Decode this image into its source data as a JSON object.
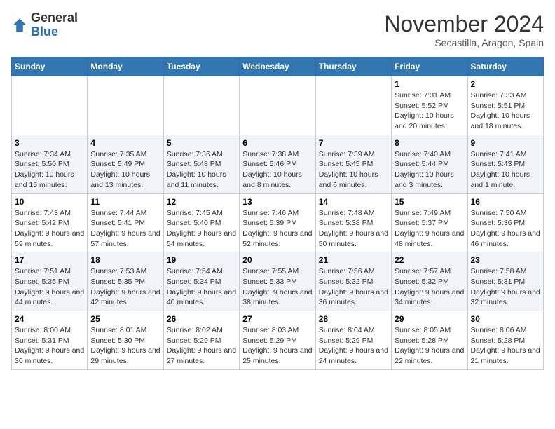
{
  "header": {
    "logo_general": "General",
    "logo_blue": "Blue",
    "month": "November 2024",
    "location": "Secastilla, Aragon, Spain"
  },
  "weekdays": [
    "Sunday",
    "Monday",
    "Tuesday",
    "Wednesday",
    "Thursday",
    "Friday",
    "Saturday"
  ],
  "weeks": [
    [
      {
        "day": "",
        "content": ""
      },
      {
        "day": "",
        "content": ""
      },
      {
        "day": "",
        "content": ""
      },
      {
        "day": "",
        "content": ""
      },
      {
        "day": "",
        "content": ""
      },
      {
        "day": "1",
        "content": "Sunrise: 7:31 AM\nSunset: 5:52 PM\nDaylight: 10 hours and 20 minutes."
      },
      {
        "day": "2",
        "content": "Sunrise: 7:33 AM\nSunset: 5:51 PM\nDaylight: 10 hours and 18 minutes."
      }
    ],
    [
      {
        "day": "3",
        "content": "Sunrise: 7:34 AM\nSunset: 5:50 PM\nDaylight: 10 hours and 15 minutes."
      },
      {
        "day": "4",
        "content": "Sunrise: 7:35 AM\nSunset: 5:49 PM\nDaylight: 10 hours and 13 minutes."
      },
      {
        "day": "5",
        "content": "Sunrise: 7:36 AM\nSunset: 5:48 PM\nDaylight: 10 hours and 11 minutes."
      },
      {
        "day": "6",
        "content": "Sunrise: 7:38 AM\nSunset: 5:46 PM\nDaylight: 10 hours and 8 minutes."
      },
      {
        "day": "7",
        "content": "Sunrise: 7:39 AM\nSunset: 5:45 PM\nDaylight: 10 hours and 6 minutes."
      },
      {
        "day": "8",
        "content": "Sunrise: 7:40 AM\nSunset: 5:44 PM\nDaylight: 10 hours and 3 minutes."
      },
      {
        "day": "9",
        "content": "Sunrise: 7:41 AM\nSunset: 5:43 PM\nDaylight: 10 hours and 1 minute."
      }
    ],
    [
      {
        "day": "10",
        "content": "Sunrise: 7:43 AM\nSunset: 5:42 PM\nDaylight: 9 hours and 59 minutes."
      },
      {
        "day": "11",
        "content": "Sunrise: 7:44 AM\nSunset: 5:41 PM\nDaylight: 9 hours and 57 minutes."
      },
      {
        "day": "12",
        "content": "Sunrise: 7:45 AM\nSunset: 5:40 PM\nDaylight: 9 hours and 54 minutes."
      },
      {
        "day": "13",
        "content": "Sunrise: 7:46 AM\nSunset: 5:39 PM\nDaylight: 9 hours and 52 minutes."
      },
      {
        "day": "14",
        "content": "Sunrise: 7:48 AM\nSunset: 5:38 PM\nDaylight: 9 hours and 50 minutes."
      },
      {
        "day": "15",
        "content": "Sunrise: 7:49 AM\nSunset: 5:37 PM\nDaylight: 9 hours and 48 minutes."
      },
      {
        "day": "16",
        "content": "Sunrise: 7:50 AM\nSunset: 5:36 PM\nDaylight: 9 hours and 46 minutes."
      }
    ],
    [
      {
        "day": "17",
        "content": "Sunrise: 7:51 AM\nSunset: 5:35 PM\nDaylight: 9 hours and 44 minutes."
      },
      {
        "day": "18",
        "content": "Sunrise: 7:53 AM\nSunset: 5:35 PM\nDaylight: 9 hours and 42 minutes."
      },
      {
        "day": "19",
        "content": "Sunrise: 7:54 AM\nSunset: 5:34 PM\nDaylight: 9 hours and 40 minutes."
      },
      {
        "day": "20",
        "content": "Sunrise: 7:55 AM\nSunset: 5:33 PM\nDaylight: 9 hours and 38 minutes."
      },
      {
        "day": "21",
        "content": "Sunrise: 7:56 AM\nSunset: 5:32 PM\nDaylight: 9 hours and 36 minutes."
      },
      {
        "day": "22",
        "content": "Sunrise: 7:57 AM\nSunset: 5:32 PM\nDaylight: 9 hours and 34 minutes."
      },
      {
        "day": "23",
        "content": "Sunrise: 7:58 AM\nSunset: 5:31 PM\nDaylight: 9 hours and 32 minutes."
      }
    ],
    [
      {
        "day": "24",
        "content": "Sunrise: 8:00 AM\nSunset: 5:31 PM\nDaylight: 9 hours and 30 minutes."
      },
      {
        "day": "25",
        "content": "Sunrise: 8:01 AM\nSunset: 5:30 PM\nDaylight: 9 hours and 29 minutes."
      },
      {
        "day": "26",
        "content": "Sunrise: 8:02 AM\nSunset: 5:29 PM\nDaylight: 9 hours and 27 minutes."
      },
      {
        "day": "27",
        "content": "Sunrise: 8:03 AM\nSunset: 5:29 PM\nDaylight: 9 hours and 25 minutes."
      },
      {
        "day": "28",
        "content": "Sunrise: 8:04 AM\nSunset: 5:29 PM\nDaylight: 9 hours and 24 minutes."
      },
      {
        "day": "29",
        "content": "Sunrise: 8:05 AM\nSunset: 5:28 PM\nDaylight: 9 hours and 22 minutes."
      },
      {
        "day": "30",
        "content": "Sunrise: 8:06 AM\nSunset: 5:28 PM\nDaylight: 9 hours and 21 minutes."
      }
    ]
  ]
}
